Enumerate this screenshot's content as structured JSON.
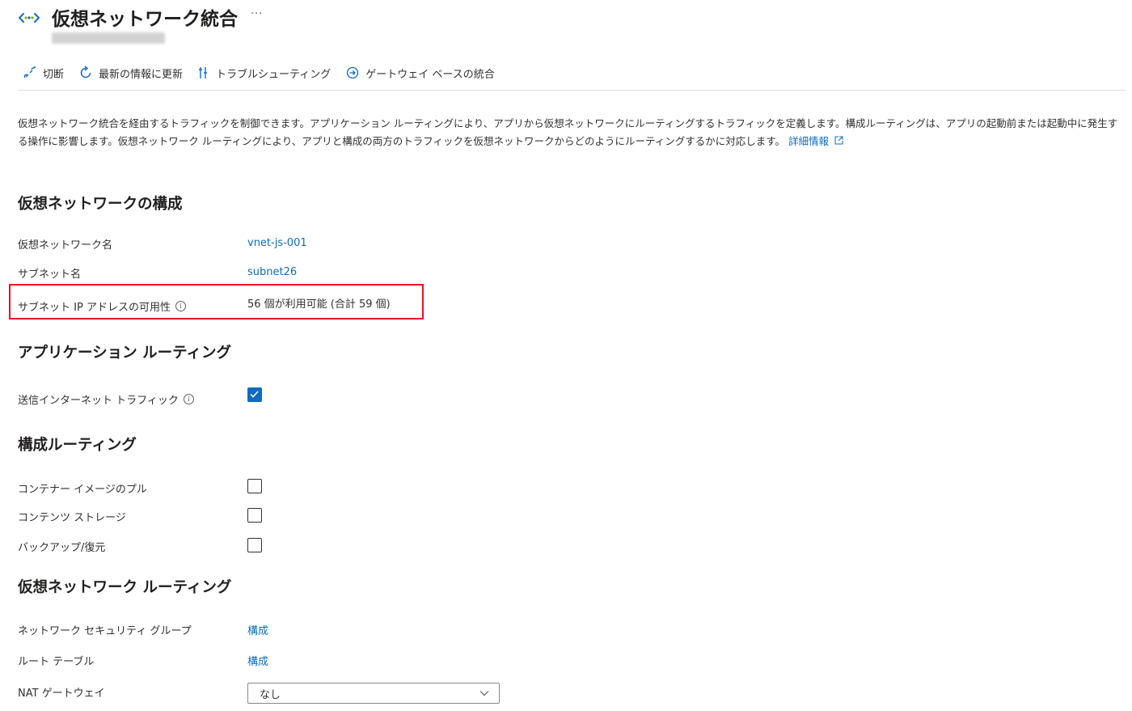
{
  "header": {
    "title": "仮想ネットワーク統合",
    "more": "···"
  },
  "toolbar": {
    "disconnect": "切断",
    "refresh": "最新の情報に更新",
    "troubleshoot": "トラブルシューティング",
    "gateway": "ゲートウェイ ベースの統合"
  },
  "description": {
    "text": "仮想ネットワーク統合を経由するトラフィックを制御できます。アプリケーション ルーティングにより、アプリから仮想ネットワークにルーティングするトラフィックを定義します。構成ルーティングは、アプリの起動前または起動中に発生する操作に影響します。仮想ネットワーク ルーティングにより、アプリと構成の両方のトラフィックを仮想ネットワークからどのようにルーティングするかに対応します。",
    "link": "詳細情報"
  },
  "vnet_config": {
    "heading": "仮想ネットワークの構成",
    "vnet_name_label": "仮想ネットワーク名",
    "vnet_name_value": "vnet-js-001",
    "subnet_label": "サブネット名",
    "subnet_value": "subnet26",
    "ip_label": "サブネット IP アドレスの可用性",
    "ip_value": "56 個が利用可能 (合計 59 個)"
  },
  "app_routing": {
    "heading": "アプリケーション ルーティング",
    "outbound_label": "送信インターネット トラフィック",
    "outbound_checked": true
  },
  "config_routing": {
    "heading": "構成ルーティング",
    "container_image_label": "コンテナー イメージのプル",
    "container_image_checked": false,
    "content_storage_label": "コンテンツ ストレージ",
    "content_storage_checked": false,
    "backup_label": "バックアップ/復元",
    "backup_checked": false
  },
  "vnet_routing": {
    "heading": "仮想ネットワーク ルーティング",
    "nsg_label": "ネットワーク セキュリティ グループ",
    "nsg_value": "構成",
    "route_table_label": "ルート テーブル",
    "route_table_value": "構成",
    "nat_label": "NAT ゲートウェイ",
    "nat_value": "なし"
  },
  "colors": {
    "accent": "#0f6cbd",
    "highlight": "#e81123"
  }
}
